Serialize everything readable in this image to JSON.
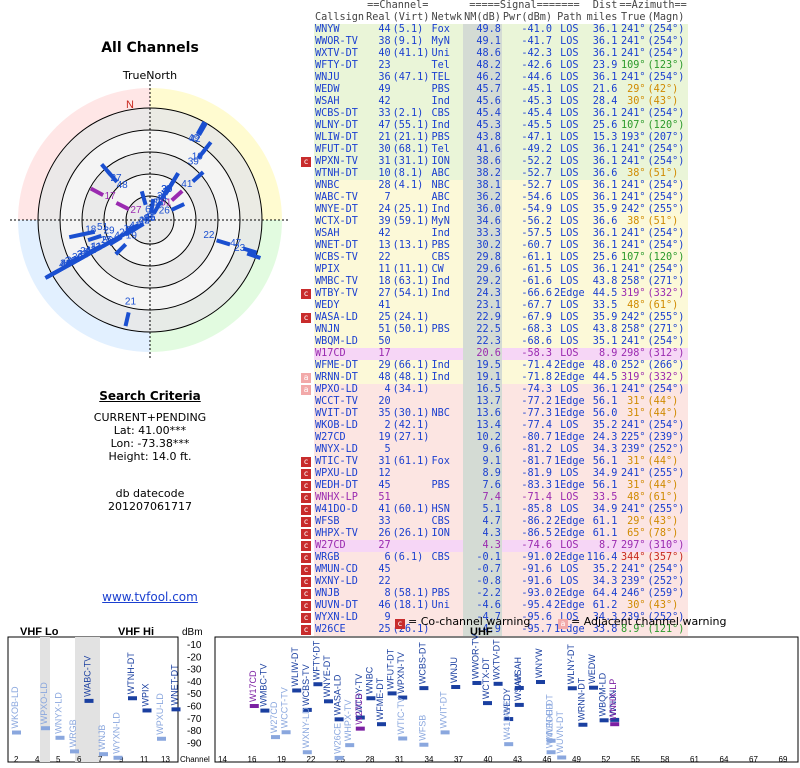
{
  "left": {
    "title": "All Channels",
    "truenorth": "TrueNorth",
    "north_marker": "N",
    "search_title": "Search Criteria",
    "search_lines": [
      "CURRENT+PENDING",
      "Lat: 41.00***",
      "Lon: -73.38***",
      "Height: 14.0 ft."
    ],
    "datecode_label": "db datecode",
    "datecode": "201207061717",
    "link": "www.tvfool.com"
  },
  "table_header": {
    "group1": "==Channel=",
    "group2": "=====Signal=======",
    "group3": "Dist",
    "group4": "==Azimuth==",
    "cols": [
      "Callsign",
      "Real",
      "(Virt)",
      "Netwk",
      "NM(dB)",
      "Pwr(dBm)",
      "Path",
      "miles",
      "True",
      "(Magn)"
    ]
  },
  "colors": {
    "green_row": "#eaf5d8",
    "yellow_row": "#fcf9d8",
    "pink_row": "#fce5e2",
    "white_row": "#ffffff",
    "green_text": "#2b9a2b",
    "blue_text": "#1a3fd0",
    "orange_text": "#d08a00",
    "red_text": "#c8281e",
    "purple_text": "#9a2ab0",
    "warn_dark": "#c82c2c",
    "warn_light": "#f2a9a9"
  },
  "stations": [
    {
      "cs": "WNYW",
      "real": "44",
      "virt": "(5.1)",
      "net": "Fox",
      "nm": "49.8",
      "pwr": "-41.0",
      "path": "LOS",
      "dist": "36.1",
      "true": "241°",
      "magn": "(254°)",
      "zone": "green",
      "tc": "blue",
      "azc": "blue",
      "warn": ""
    },
    {
      "cs": "WWOR-TV",
      "real": "38",
      "virt": "(9.1)",
      "net": "MyN",
      "nm": "49.1",
      "pwr": "-41.7",
      "path": "LOS",
      "dist": "36.1",
      "true": "241°",
      "magn": "(254°)",
      "zone": "green",
      "tc": "blue",
      "azc": "blue",
      "warn": ""
    },
    {
      "cs": "WXTV-DT",
      "real": "40",
      "virt": "(41.1)",
      "net": "Uni",
      "nm": "48.6",
      "pwr": "-42.3",
      "path": "LOS",
      "dist": "36.1",
      "true": "241°",
      "magn": "(254°)",
      "zone": "green",
      "tc": "blue",
      "azc": "blue",
      "warn": ""
    },
    {
      "cs": "WFTY-DT",
      "real": "23",
      "virt": "",
      "net": "Tel",
      "nm": "48.2",
      "pwr": "-42.6",
      "path": "LOS",
      "dist": "23.9",
      "true": "109°",
      "magn": "(123°)",
      "zone": "green",
      "tc": "blue",
      "azc": "green",
      "warn": ""
    },
    {
      "cs": "WNJU",
      "real": "36",
      "virt": "(47.1)",
      "net": "TEL",
      "nm": "46.2",
      "pwr": "-44.6",
      "path": "LOS",
      "dist": "36.1",
      "true": "241°",
      "magn": "(254°)",
      "zone": "green",
      "tc": "blue",
      "azc": "blue",
      "warn": ""
    },
    {
      "cs": "WEDW",
      "real": "49",
      "virt": "",
      "net": "PBS",
      "nm": "45.7",
      "pwr": "-45.1",
      "path": "LOS",
      "dist": "21.6",
      "true": "29°",
      "magn": "(42°)",
      "zone": "green",
      "tc": "blue",
      "azc": "orange",
      "warn": ""
    },
    {
      "cs": "WSAH",
      "real": "42",
      "virt": "",
      "net": "Ind",
      "nm": "45.6",
      "pwr": "-45.3",
      "path": "LOS",
      "dist": "28.4",
      "true": "30°",
      "magn": "(43°)",
      "zone": "green",
      "tc": "blue",
      "azc": "orange",
      "warn": ""
    },
    {
      "cs": "WCBS-DT",
      "real": "33",
      "virt": "(2.1)",
      "net": "CBS",
      "nm": "45.4",
      "pwr": "-45.4",
      "path": "LOS",
      "dist": "36.1",
      "true": "241°",
      "magn": "(254°)",
      "zone": "green",
      "tc": "blue",
      "azc": "blue",
      "warn": ""
    },
    {
      "cs": "WLNY-DT",
      "real": "47",
      "virt": "(55.1)",
      "net": "Ind",
      "nm": "45.3",
      "pwr": "-45.5",
      "path": "LOS",
      "dist": "25.6",
      "true": "107°",
      "magn": "(120°)",
      "zone": "green",
      "tc": "blue",
      "azc": "green",
      "warn": ""
    },
    {
      "cs": "WLIW-DT",
      "real": "21",
      "virt": "(21.1)",
      "net": "PBS",
      "nm": "43.8",
      "pwr": "-47.1",
      "path": "LOS",
      "dist": "15.3",
      "true": "193°",
      "magn": "(207°)",
      "zone": "green",
      "tc": "blue",
      "azc": "blue",
      "warn": ""
    },
    {
      "cs": "WFUT-DT",
      "real": "30",
      "virt": "(68.1)",
      "net": "Tel",
      "nm": "41.6",
      "pwr": "-49.2",
      "path": "LOS",
      "dist": "36.1",
      "true": "241°",
      "magn": "(254°)",
      "zone": "green",
      "tc": "blue",
      "azc": "blue",
      "warn": ""
    },
    {
      "cs": "WPXN-TV",
      "real": "31",
      "virt": "(31.1)",
      "net": "ION",
      "nm": "38.6",
      "pwr": "-52.2",
      "path": "LOS",
      "dist": "36.1",
      "true": "241°",
      "magn": "(254°)",
      "zone": "green",
      "tc": "blue",
      "azc": "blue",
      "warn": "c"
    },
    {
      "cs": "WTNH-DT",
      "real": "10",
      "virt": "(8.1)",
      "net": "ABC",
      "nm": "38.2",
      "pwr": "-52.7",
      "path": "LOS",
      "dist": "36.6",
      "true": "38°",
      "magn": "(51°)",
      "zone": "green",
      "tc": "blue",
      "azc": "orange",
      "warn": ""
    },
    {
      "cs": "WNBC",
      "real": "28",
      "virt": "(4.1)",
      "net": "NBC",
      "nm": "38.1",
      "pwr": "-52.7",
      "path": "LOS",
      "dist": "36.1",
      "true": "241°",
      "magn": "(254°)",
      "zone": "yellow",
      "tc": "blue",
      "azc": "blue",
      "warn": ""
    },
    {
      "cs": "WABC-TV",
      "real": "7",
      "virt": "",
      "net": "ABC",
      "nm": "36.2",
      "pwr": "-54.6",
      "path": "LOS",
      "dist": "36.1",
      "true": "241°",
      "magn": "(254°)",
      "zone": "yellow",
      "tc": "blue",
      "azc": "blue",
      "warn": ""
    },
    {
      "cs": "WNYE-DT",
      "real": "24",
      "virt": "(25.1)",
      "net": "Ind",
      "nm": "36.0",
      "pwr": "-54.9",
      "path": "LOS",
      "dist": "35.9",
      "true": "242°",
      "magn": "(255°)",
      "zone": "yellow",
      "tc": "blue",
      "azc": "blue",
      "warn": ""
    },
    {
      "cs": "WCTX-DT",
      "real": "39",
      "virt": "(59.1)",
      "net": "MyN",
      "nm": "34.6",
      "pwr": "-56.2",
      "path": "LOS",
      "dist": "36.6",
      "true": "38°",
      "magn": "(51°)",
      "zone": "yellow",
      "tc": "blue",
      "azc": "orange",
      "warn": ""
    },
    {
      "cs": "WSAH",
      "real": "42",
      "virt": "",
      "net": "Ind",
      "nm": "33.3",
      "pwr": "-57.5",
      "path": "LOS",
      "dist": "36.1",
      "true": "241°",
      "magn": "(254°)",
      "zone": "yellow",
      "tc": "blue",
      "azc": "blue",
      "warn": ""
    },
    {
      "cs": "WNET-DT",
      "real": "13",
      "virt": "(13.1)",
      "net": "PBS",
      "nm": "30.2",
      "pwr": "-60.7",
      "path": "LOS",
      "dist": "36.1",
      "true": "241°",
      "magn": "(254°)",
      "zone": "yellow",
      "tc": "blue",
      "azc": "blue",
      "warn": ""
    },
    {
      "cs": "WCBS-TV",
      "real": "22",
      "virt": "",
      "net": "CBS",
      "nm": "29.8",
      "pwr": "-61.1",
      "path": "LOS",
      "dist": "25.6",
      "true": "107°",
      "magn": "(120°)",
      "zone": "yellow",
      "tc": "blue",
      "azc": "green",
      "warn": ""
    },
    {
      "cs": "WPIX",
      "real": "11",
      "virt": "(11.1)",
      "net": "CW",
      "nm": "29.6",
      "pwr": "-61.5",
      "path": "LOS",
      "dist": "36.1",
      "true": "241°",
      "magn": "(254°)",
      "zone": "yellow",
      "tc": "blue",
      "azc": "blue",
      "warn": ""
    },
    {
      "cs": "WMBC-TV",
      "real": "18",
      "virt": "(63.1)",
      "net": "Ind",
      "nm": "29.2",
      "pwr": "-61.6",
      "path": "LOS",
      "dist": "43.8",
      "true": "258°",
      "magn": "(271°)",
      "zone": "yellow",
      "tc": "blue",
      "azc": "blue",
      "warn": ""
    },
    {
      "cs": "WTBY-TV",
      "real": "27",
      "virt": "(54.1)",
      "net": "Ind",
      "nm": "24.3",
      "pwr": "-66.6",
      "path": "2Edge",
      "dist": "44.5",
      "true": "319°",
      "magn": "(332°)",
      "zone": "yellow",
      "tc": "blue",
      "azc": "purple",
      "warn": "ca"
    },
    {
      "cs": "WEDY",
      "real": "41",
      "virt": "",
      "net": "",
      "nm": "23.1",
      "pwr": "-67.7",
      "path": "LOS",
      "dist": "33.5",
      "true": "48°",
      "magn": "(61°)",
      "zone": "yellow",
      "tc": "blue",
      "azc": "orange",
      "warn": ""
    },
    {
      "cs": "WASA-LD",
      "real": "25",
      "virt": "(24.1)",
      "net": "",
      "nm": "22.9",
      "pwr": "-67.9",
      "path": "LOS",
      "dist": "35.9",
      "true": "242°",
      "magn": "(255°)",
      "zone": "yellow",
      "tc": "blue",
      "azc": "blue",
      "warn": "ca"
    },
    {
      "cs": "WNJN",
      "real": "51",
      "virt": "(50.1)",
      "net": "PBS",
      "nm": "22.5",
      "pwr": "-68.3",
      "path": "LOS",
      "dist": "43.8",
      "true": "258°",
      "magn": "(271°)",
      "zone": "yellow",
      "tc": "blue",
      "azc": "blue",
      "warn": ""
    },
    {
      "cs": "WBQM-LD",
      "real": "50",
      "virt": "",
      "net": "",
      "nm": "22.3",
      "pwr": "-68.6",
      "path": "LOS",
      "dist": "35.1",
      "true": "241°",
      "magn": "(254°)",
      "zone": "yellow",
      "tc": "blue",
      "azc": "blue",
      "warn": ""
    },
    {
      "cs": "W17CD",
      "real": "17",
      "virt": "",
      "net": "",
      "nm": "20.6",
      "pwr": "-58.3",
      "path": "LOS",
      "dist": "8.9",
      "true": "298°",
      "magn": "(312°)",
      "zone": "pinkhl",
      "tc": "purple",
      "azc": "purple",
      "warn": ""
    },
    {
      "cs": "WFME-DT",
      "real": "29",
      "virt": "(66.1)",
      "net": "Ind",
      "nm": "19.5",
      "pwr": "-71.4",
      "path": "2Edge",
      "dist": "48.0",
      "true": "252°",
      "magn": "(266°)",
      "zone": "yellow",
      "tc": "blue",
      "azc": "blue",
      "warn": ""
    },
    {
      "cs": "WRNN-DT",
      "real": "48",
      "virt": "(48.1)",
      "net": "Ind",
      "nm": "19.1",
      "pwr": "-71.8",
      "path": "2Edge",
      "dist": "44.5",
      "true": "319°",
      "magn": "(332°)",
      "zone": "yellow",
      "tc": "blue",
      "azc": "purple",
      "warn": "a"
    },
    {
      "cs": "WPXO-LD",
      "real": "4",
      "virt": "(34.1)",
      "net": "",
      "nm": "16.5",
      "pwr": "-74.3",
      "path": "LOS",
      "dist": "36.1",
      "true": "241°",
      "magn": "(254°)",
      "zone": "pink",
      "tc": "blue",
      "azc": "blue",
      "warn": "a"
    },
    {
      "cs": "WCCT-TV",
      "real": "20",
      "virt": "",
      "net": "",
      "nm": "13.7",
      "pwr": "-77.2",
      "path": "1Edge",
      "dist": "56.1",
      "true": "31°",
      "magn": "(44°)",
      "zone": "pink",
      "tc": "blue",
      "azc": "orange",
      "warn": ""
    },
    {
      "cs": "WVIT-DT",
      "real": "35",
      "virt": "(30.1)",
      "net": "NBC",
      "nm": "13.6",
      "pwr": "-77.3",
      "path": "1Edge",
      "dist": "56.0",
      "true": "31°",
      "magn": "(44°)",
      "zone": "pink",
      "tc": "blue",
      "azc": "orange",
      "warn": ""
    },
    {
      "cs": "WKOB-LD",
      "real": "2",
      "virt": "(42.1)",
      "net": "",
      "nm": "13.4",
      "pwr": "-77.4",
      "path": "LOS",
      "dist": "35.2",
      "true": "241°",
      "magn": "(254°)",
      "zone": "pink",
      "tc": "blue",
      "azc": "blue",
      "warn": ""
    },
    {
      "cs": "W27CD",
      "real": "19",
      "virt": "(27.1)",
      "net": "",
      "nm": "10.2",
      "pwr": "-80.7",
      "path": "1Edge",
      "dist": "24.3",
      "true": "225°",
      "magn": "(239°)",
      "zone": "pink",
      "tc": "blue",
      "azc": "blue",
      "warn": ""
    },
    {
      "cs": "WNYX-LD",
      "real": "5",
      "virt": "",
      "net": "",
      "nm": "9.6",
      "pwr": "-81.2",
      "path": "LOS",
      "dist": "34.3",
      "true": "239°",
      "magn": "(252°)",
      "zone": "pink",
      "tc": "blue",
      "azc": "blue",
      "warn": ""
    },
    {
      "cs": "WTIC-TV",
      "real": "31",
      "virt": "(61.1)",
      "net": "Fox",
      "nm": "9.1",
      "pwr": "-81.7",
      "path": "1Edge",
      "dist": "56.1",
      "true": "31°",
      "magn": "(44°)",
      "zone": "pink",
      "tc": "blue",
      "azc": "orange",
      "warn": "c"
    },
    {
      "cs": "WPXU-LD",
      "real": "12",
      "virt": "",
      "net": "",
      "nm": "8.9",
      "pwr": "-81.9",
      "path": "LOS",
      "dist": "34.9",
      "true": "241°",
      "magn": "(255°)",
      "zone": "pink",
      "tc": "blue",
      "azc": "blue",
      "warn": "c"
    },
    {
      "cs": "WEDH-DT",
      "real": "45",
      "virt": "",
      "net": "PBS",
      "nm": "7.6",
      "pwr": "-83.3",
      "path": "1Edge",
      "dist": "56.1",
      "true": "31°",
      "magn": "(44°)",
      "zone": "pink",
      "tc": "blue",
      "azc": "orange",
      "warn": "c"
    },
    {
      "cs": "WNHX-LP",
      "real": "51",
      "virt": "",
      "net": "",
      "nm": "7.4",
      "pwr": "-71.4",
      "path": "LOS",
      "dist": "33.5",
      "true": "48°",
      "magn": "(61°)",
      "zone": "pink",
      "tc": "purple",
      "azc": "orange",
      "warn": "c"
    },
    {
      "cs": "W41DO-D",
      "real": "41",
      "virt": "(60.1)",
      "net": "HSN",
      "nm": "5.1",
      "pwr": "-85.8",
      "path": "LOS",
      "dist": "34.9",
      "true": "241°",
      "magn": "(255°)",
      "zone": "pink",
      "tc": "blue",
      "azc": "blue",
      "warn": "c"
    },
    {
      "cs": "WFSB",
      "real": "33",
      "virt": "",
      "net": "CBS",
      "nm": "4.7",
      "pwr": "-86.2",
      "path": "2Edge",
      "dist": "61.1",
      "true": "29°",
      "magn": "(43°)",
      "zone": "pink",
      "tc": "blue",
      "azc": "orange",
      "warn": "c"
    },
    {
      "cs": "WHPX-TV",
      "real": "26",
      "virt": "(26.1)",
      "net": "ION",
      "nm": "4.3",
      "pwr": "-86.5",
      "path": "2Edge",
      "dist": "61.1",
      "true": "65°",
      "magn": "(78°)",
      "zone": "pink",
      "tc": "blue",
      "azc": "orange",
      "warn": "c"
    },
    {
      "cs": "W27CD",
      "real": "27",
      "virt": "",
      "net": "",
      "nm": "4.3",
      "pwr": "-74.6",
      "path": "LOS",
      "dist": "8.7",
      "true": "297°",
      "magn": "(310°)",
      "zone": "pinkhl",
      "tc": "purple",
      "azc": "purple",
      "warn": "c"
    },
    {
      "cs": "WRGB",
      "real": "6",
      "virt": "(6.1)",
      "net": "CBS",
      "nm": "-0.1",
      "pwr": "-91.0",
      "path": "2Edge",
      "dist": "116.4",
      "true": "344°",
      "magn": "(357°)",
      "zone": "pink",
      "tc": "blue",
      "azc": "red",
      "warn": "c"
    },
    {
      "cs": "WMUN-CD",
      "real": "45",
      "virt": "",
      "net": "",
      "nm": "-0.7",
      "pwr": "-91.6",
      "path": "LOS",
      "dist": "35.2",
      "true": "241°",
      "magn": "(254°)",
      "zone": "pink",
      "tc": "blue",
      "azc": "blue",
      "warn": "c"
    },
    {
      "cs": "WXNY-LD",
      "real": "22",
      "virt": "",
      "net": "",
      "nm": "-0.8",
      "pwr": "-91.6",
      "path": "LOS",
      "dist": "34.3",
      "true": "239°",
      "magn": "(252°)",
      "zone": "pink",
      "tc": "blue",
      "azc": "blue",
      "warn": "c"
    },
    {
      "cs": "WNJB",
      "real": "8",
      "virt": "(58.1)",
      "net": "PBS",
      "nm": "-2.2",
      "pwr": "-93.0",
      "path": "2Edge",
      "dist": "64.4",
      "true": "246°",
      "magn": "(259°)",
      "zone": "pink",
      "tc": "blue",
      "azc": "blue",
      "warn": "c"
    },
    {
      "cs": "WUVN-DT",
      "real": "46",
      "virt": "(18.1)",
      "net": "Uni",
      "nm": "-4.6",
      "pwr": "-95.4",
      "path": "2Edge",
      "dist": "61.2",
      "true": "30°",
      "magn": "(43°)",
      "zone": "pink",
      "tc": "blue",
      "azc": "orange",
      "warn": "c"
    },
    {
      "cs": "WYXN-LD",
      "real": "9",
      "virt": "",
      "net": "",
      "nm": "-4.7",
      "pwr": "-95.6",
      "path": "LOS",
      "dist": "34.3",
      "true": "239°",
      "magn": "(252°)",
      "zone": "pink",
      "tc": "blue",
      "azc": "blue",
      "warn": "c"
    },
    {
      "cs": "W26CE",
      "real": "25",
      "virt": "(26.1)",
      "net": "",
      "nm": "-4.9",
      "pwr": "-95.7",
      "path": "1Edge",
      "dist": "33.8",
      "true": "8.9°",
      "magn": "(121°)",
      "zone": "pink",
      "tc": "blue",
      "azc": "green",
      "warn": "c"
    }
  ],
  "polar": {
    "rings": [
      "41",
      "42",
      "40",
      "29",
      "33",
      "35",
      "21",
      "26",
      "27",
      "17",
      "48",
      "25",
      "22",
      "47",
      "18",
      "44",
      "38",
      "30",
      "19",
      "13",
      "11",
      "8",
      "5",
      "4",
      "2",
      "12",
      "6",
      "7",
      "10",
      "9",
      "31",
      "51",
      "49",
      "45",
      "24",
      "23",
      "28",
      "36",
      "39"
    ]
  },
  "legend": {
    "cochannel": "= Co-channel warning",
    "adjacent": "= Adjacent channel warning",
    "co_icon": "c",
    "adj_icon": "a"
  },
  "bands": {
    "vhf_lo": "VHF Lo",
    "vhf_hi": "VHF Hi",
    "uhf": "UHF",
    "dbm_label": "dBm",
    "channel_label": "Channel",
    "db_ticks": [
      "-10",
      "-20",
      "-30",
      "-40",
      "-50",
      "-60",
      "-70",
      "-80",
      "-90"
    ],
    "vhf_channels": [
      "2",
      "4",
      "5",
      "6",
      "7",
      "9",
      "11",
      "13"
    ],
    "uhf_channels": [
      "14",
      "16",
      "19",
      "22",
      "25",
      "28",
      "31",
      "34",
      "37",
      "40",
      "43",
      "46",
      "49",
      "52",
      "55",
      "58",
      "61",
      "64",
      "67",
      "69"
    ]
  }
}
